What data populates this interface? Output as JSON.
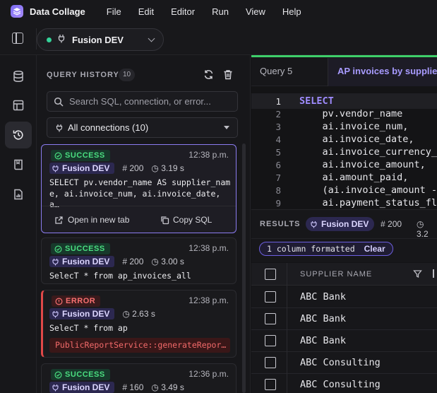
{
  "app": {
    "name": "Data Collage",
    "logo_icon": "stack-layers-icon"
  },
  "menu": [
    "File",
    "Edit",
    "Editor",
    "Run",
    "View",
    "Help"
  ],
  "toolbar": {
    "connection": "Fusion DEV",
    "connection_status_color": "#34d399"
  },
  "history": {
    "title": "QUERY HISTORY",
    "count": "10",
    "search_placeholder": "Search SQL, connection, or error...",
    "filter_label": "All connections (10)",
    "items": [
      {
        "status": "SUCCESS",
        "time": "12:38 p.m.",
        "connection": "Fusion DEV",
        "rows": "200",
        "duration": "3.19 s",
        "sql": "SELECT pv.vendor_name AS supplier_name, ai.invoice_num, ai.invoice_date, a…",
        "open_label": "Open in new tab",
        "copy_label": "Copy SQL"
      },
      {
        "status": "SUCCESS",
        "time": "12:38 p.m.",
        "connection": "Fusion DEV",
        "rows": "200",
        "duration": "3.00 s",
        "sql": "SelecT * from ap_invoices_all"
      },
      {
        "status": "ERROR",
        "time": "12:38 p.m.",
        "connection": "Fusion DEV",
        "duration": "2.63 s",
        "sql": "SelecT * from ap",
        "error": "PublicReportService::generateReport for repor..."
      },
      {
        "status": "SUCCESS",
        "time": "12:36 p.m.",
        "connection": "Fusion DEV",
        "rows": "160",
        "duration": "3.49 s"
      }
    ]
  },
  "tabs": [
    {
      "label": "Query 5",
      "active": false
    },
    {
      "label": "AP invoices by supplier",
      "active": true
    }
  ],
  "editor": {
    "lines": [
      {
        "n": "1",
        "text": "SELECT"
      },
      {
        "n": "2",
        "text": "    pv.vendor_name"
      },
      {
        "n": "3",
        "text": "    ai.invoice_num,"
      },
      {
        "n": "4",
        "text": "    ai.invoice_date,"
      },
      {
        "n": "5",
        "text": "    ai.invoice_currency_"
      },
      {
        "n": "6",
        "text": "    ai.invoice_amount,"
      },
      {
        "n": "7",
        "text": "    ai.amount_paid,"
      },
      {
        "n": "8",
        "text": "    (ai.invoice_amount -"
      },
      {
        "n": "9",
        "text": "    ai.payment_status_fl"
      }
    ]
  },
  "results": {
    "title": "RESULTS",
    "connection": "Fusion DEV",
    "rows": "200",
    "duration": "3.2",
    "format_note": "1 column formatted",
    "clear_label": "Clear",
    "column_header": "SUPPLIER NAME",
    "rows_data": [
      "ABC Bank",
      "ABC Bank",
      "ABC Bank",
      "ABC Consulting",
      "ABC Consulting"
    ]
  },
  "colors": {
    "accent": "#8b7cf0",
    "success": "#4ade80",
    "error": "#f87171",
    "tab_accent": "#3ecf6a"
  }
}
